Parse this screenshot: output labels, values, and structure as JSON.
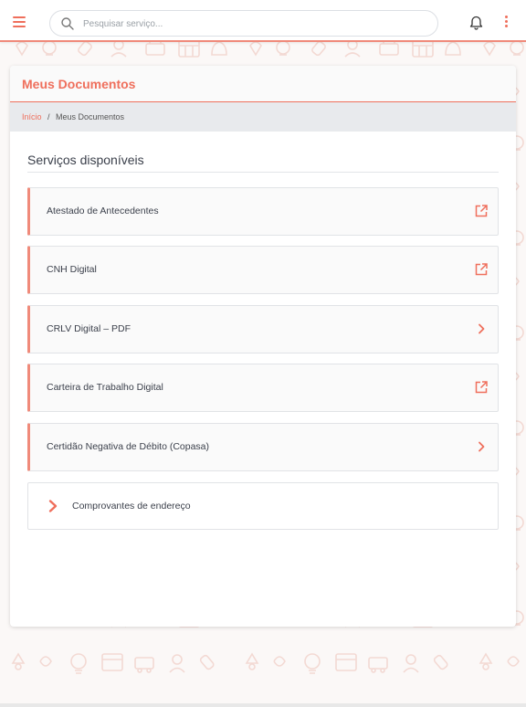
{
  "colors": {
    "accent": "#ef6f5c",
    "header_bg": "#ffffff",
    "breadcrumb_bg": "#e8eaed"
  },
  "topbar": {
    "search_placeholder": "Pesquisar serviço...",
    "menu_icon": "hamburger-icon",
    "notification_icon": "bell-icon",
    "more_icon": "kebab-menu-icon"
  },
  "page": {
    "title": "Meus Documentos",
    "breadcrumb": {
      "home": "Início",
      "separator": "/",
      "current": "Meus Documentos"
    },
    "section_title": "Serviços disponíveis"
  },
  "services": [
    {
      "label": "Atestado de Antecedentes",
      "icon": "external-link-icon"
    },
    {
      "label": "CNH Digital",
      "icon": "external-link-icon"
    },
    {
      "label": "CRLV Digital – PDF",
      "icon": "chevron-right-icon"
    },
    {
      "label": "Carteira de Trabalho Digital",
      "icon": "external-link-icon"
    },
    {
      "label": "Certidão Negativa de Débito (Copasa)",
      "icon": "chevron-right-icon"
    }
  ],
  "group_item": {
    "label": "Comprovantes de endereço",
    "icon": "chevron-right-icon"
  }
}
